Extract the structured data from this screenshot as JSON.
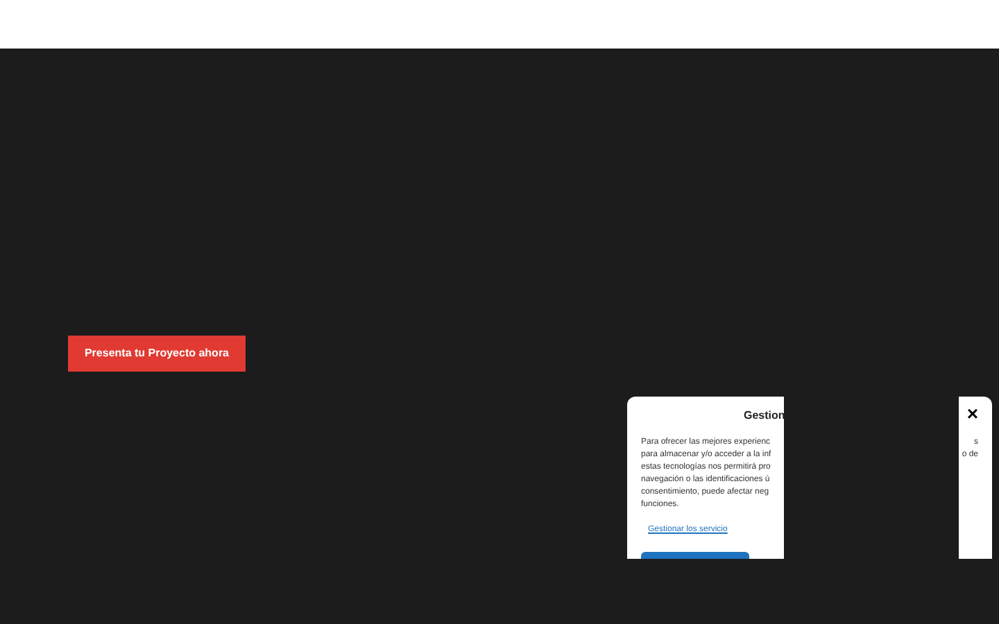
{
  "hero": {
    "cta_button": "Presenta tu Proyecto ahora"
  },
  "cookie_dialog": {
    "title": "Gestion",
    "close": "×",
    "text_left_lines": [
      "Para ofrecer las mejores experienc",
      "para almacenar y/o acceder a la inf",
      "estas tecnologías nos permitirá pro",
      "navegación o las identificaciones ú",
      "consentimiento, puede afectar neg",
      "funciones."
    ],
    "text_right_lines": [
      "s",
      "o de"
    ],
    "link": "Gestionar los servicio"
  }
}
